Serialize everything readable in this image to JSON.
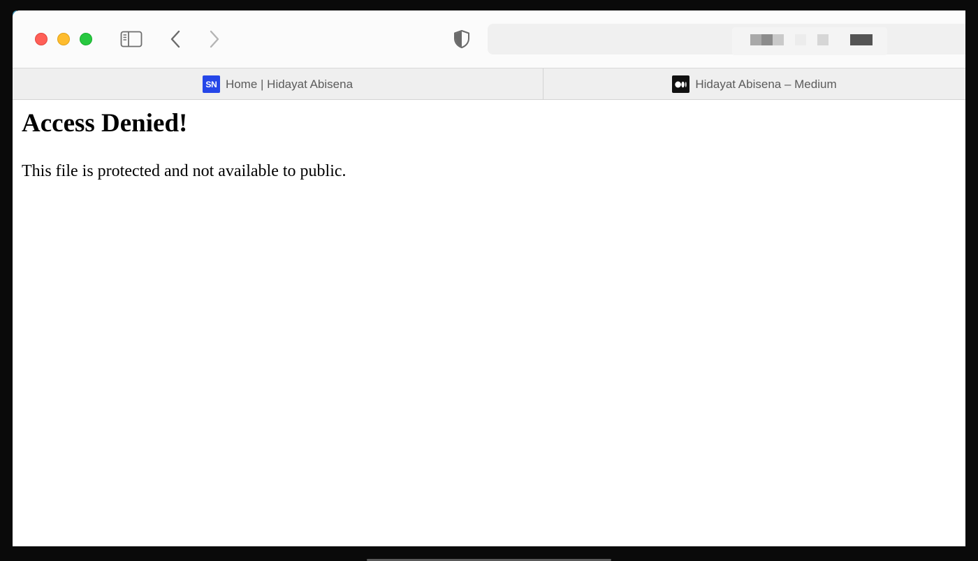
{
  "tabs": [
    {
      "favicon_text": "SN",
      "label": "Home | Hidayat Abisena"
    },
    {
      "favicon_icon": "medium-logo-icon",
      "label": "Hidayat Abisena – Medium"
    }
  ],
  "toolbar": {
    "icons": [
      "sidebar-toggle-icon",
      "back-chevron-icon",
      "forward-chevron-icon",
      "privacy-shield-icon"
    ]
  },
  "page": {
    "heading": "Access Denied!",
    "message": "This file is protected and not available to public."
  },
  "colors": {
    "close": "#ff5f57",
    "minimize": "#febc2e",
    "maximize": "#28c840",
    "sn_favicon": "#2546e8",
    "medium_favicon": "#111111"
  }
}
